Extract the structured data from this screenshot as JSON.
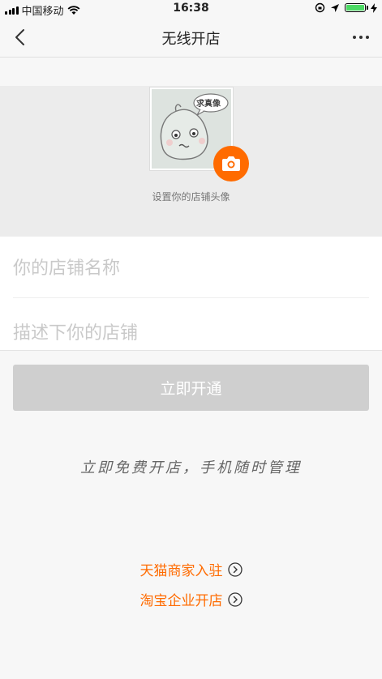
{
  "status_bar": {
    "carrier": "中国移动",
    "time": "16:38"
  },
  "nav": {
    "title": "无线开店"
  },
  "avatar": {
    "badge_text": "求真像",
    "hint": "设置你的店铺头像"
  },
  "form": {
    "shop_name_placeholder": "你的店铺名称",
    "shop_desc_placeholder": "描述下你的店铺"
  },
  "actions": {
    "open_label": "立即开通"
  },
  "slogan": "立即免费开店，手机随时管理",
  "links": {
    "tmall": "天猫商家入驻",
    "taobao": "淘宝企业开店"
  },
  "colors": {
    "accent": "#ff6b00",
    "disabled_button": "#cfcfcf",
    "battery": "#4cd964"
  },
  "icons": {
    "back": "back-arrow-icon",
    "more": "more-dots-icon",
    "camera": "camera-icon",
    "wifi": "wifi-icon",
    "link_arrow": "circle-chevron-right-icon"
  }
}
